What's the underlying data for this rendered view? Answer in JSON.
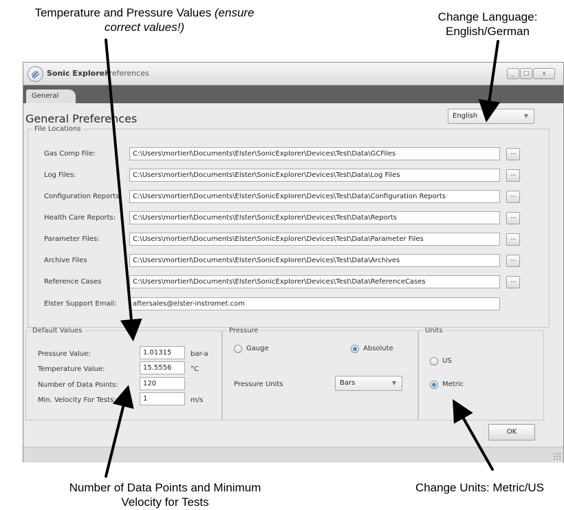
{
  "annotations": {
    "temp_pressure_line1": "Temperature and Pressure Values ",
    "temp_pressure_note1": "(ensure",
    "temp_pressure_note2": "correct values!)",
    "language_line1": "Change Language:",
    "language_line2": "English/German",
    "datapoints_line1": "Number of Data Points and Minimum",
    "datapoints_line2": "Velocity for Tests",
    "units_line": "Change Units: Metric/US"
  },
  "window": {
    "app_name": "Sonic Explorer",
    "title": "Preferences",
    "controls": [
      "_",
      "□",
      "x"
    ]
  },
  "tabs": [
    {
      "label": "General",
      "active": true
    }
  ],
  "page": {
    "heading": "General Preferences",
    "language_select": {
      "value": "English"
    }
  },
  "file_locations": {
    "legend": "File Locations",
    "browse_label": "...",
    "rows": [
      {
        "label": "Gas Comp File:",
        "value": "C:\\Users\\mortierl\\Documents\\Elster\\SonicExplorer\\Devices\\Test\\Data\\GCFiles"
      },
      {
        "label": "Log Files:",
        "value": "C:\\Users\\mortierl\\Documents\\Elster\\SonicExplorer\\Devices\\Test\\Data\\Log Files"
      },
      {
        "label": "Configuration Reports:",
        "value": "C:\\Users\\mortierl\\Documents\\Elster\\SonicExplorer\\Devices\\Test\\Data\\Configuration Reports"
      },
      {
        "label": "Health Care Reports:",
        "value": "C:\\Users\\mortierl\\Documents\\Elster\\SonicExplorer\\Devices\\Test\\Data\\Reports"
      },
      {
        "label": "Parameter Files:",
        "value": "C:\\Users\\mortierl\\Documents\\Elster\\SonicExplorer\\Devices\\Test\\Data\\Parameter Files"
      },
      {
        "label": "Archive Files",
        "value": "C:\\Users\\mortierl\\Documents\\Elster\\SonicExplorer\\Devices\\Test\\Data\\Archives"
      },
      {
        "label": "Reference Cases",
        "value": "C:\\Users\\mortierl\\Documents\\Elster\\SonicExplorer\\Devices\\Test\\Data\\ReferenceCases"
      }
    ],
    "support_email": {
      "label": "Elster Support Email:",
      "value": "aftersales@elster-instromet.com"
    }
  },
  "default_values": {
    "legend": "Default Values",
    "pressure": {
      "label": "Pressure Value:",
      "value": "1.01315",
      "unit": "bar-a"
    },
    "temperature": {
      "label": "Temperature Value:",
      "value": "15.5556",
      "unit": "°C"
    },
    "data_points": {
      "label": "Number of Data Points:",
      "value": "120"
    },
    "min_velocity": {
      "label": "Min. Velocity For Tests:",
      "value": "1",
      "unit": "m/s"
    }
  },
  "pressure": {
    "legend": "Pressure",
    "gauge_label": "Gauge",
    "absolute_label": "Absolute",
    "selected": "Absolute",
    "units_label": "Pressure Units",
    "units_value": "Bars"
  },
  "units": {
    "legend": "Units",
    "us_label": "US",
    "metric_label": "Metric",
    "selected": "Metric"
  },
  "actions": {
    "ok_label": "OK"
  },
  "icons": {
    "app_logo": "sonic-explorer-logo-icon",
    "dropdown": "chevron-down-icon",
    "resize": "resize-grip-icon"
  }
}
